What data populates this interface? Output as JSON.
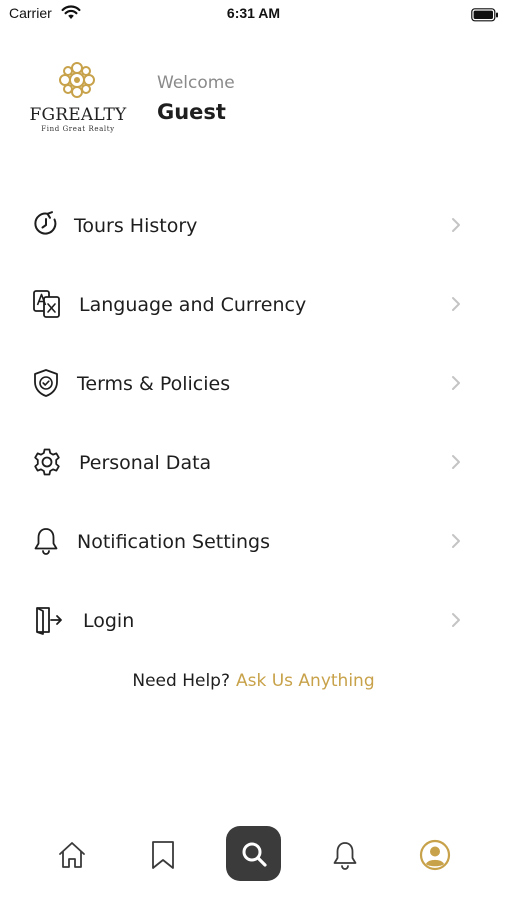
{
  "status_bar": {
    "carrier": "Carrier",
    "time": "6:31 AM"
  },
  "header": {
    "logo": {
      "name": "FGREALTY",
      "tagline": "Find Great Realty",
      "color": "#c8a24a"
    },
    "welcome": "Welcome",
    "user_name": "Guest"
  },
  "menu": {
    "items": [
      {
        "label": "Tours History",
        "icon": "history-icon"
      },
      {
        "label": "Language and Currency",
        "icon": "translate-icon"
      },
      {
        "label": "Terms & Policies",
        "icon": "shield-check-icon"
      },
      {
        "label": "Personal Data",
        "icon": "gear-icon"
      },
      {
        "label": "Notification Settings",
        "icon": "bell-icon"
      },
      {
        "label": "Login",
        "icon": "login-icon"
      }
    ]
  },
  "help": {
    "text": "Need Help?",
    "link": "Ask Us Anything",
    "link_color": "#c8a24a"
  },
  "tabbar": {
    "tabs": [
      {
        "icon": "home-icon",
        "active": false
      },
      {
        "icon": "bookmark-icon",
        "active": false
      },
      {
        "icon": "search-icon",
        "active": false
      },
      {
        "icon": "bell-icon",
        "active": false
      },
      {
        "icon": "profile-icon",
        "active": true
      }
    ],
    "active_color": "#c8a24a",
    "search_bg": "#3b3b3b"
  }
}
